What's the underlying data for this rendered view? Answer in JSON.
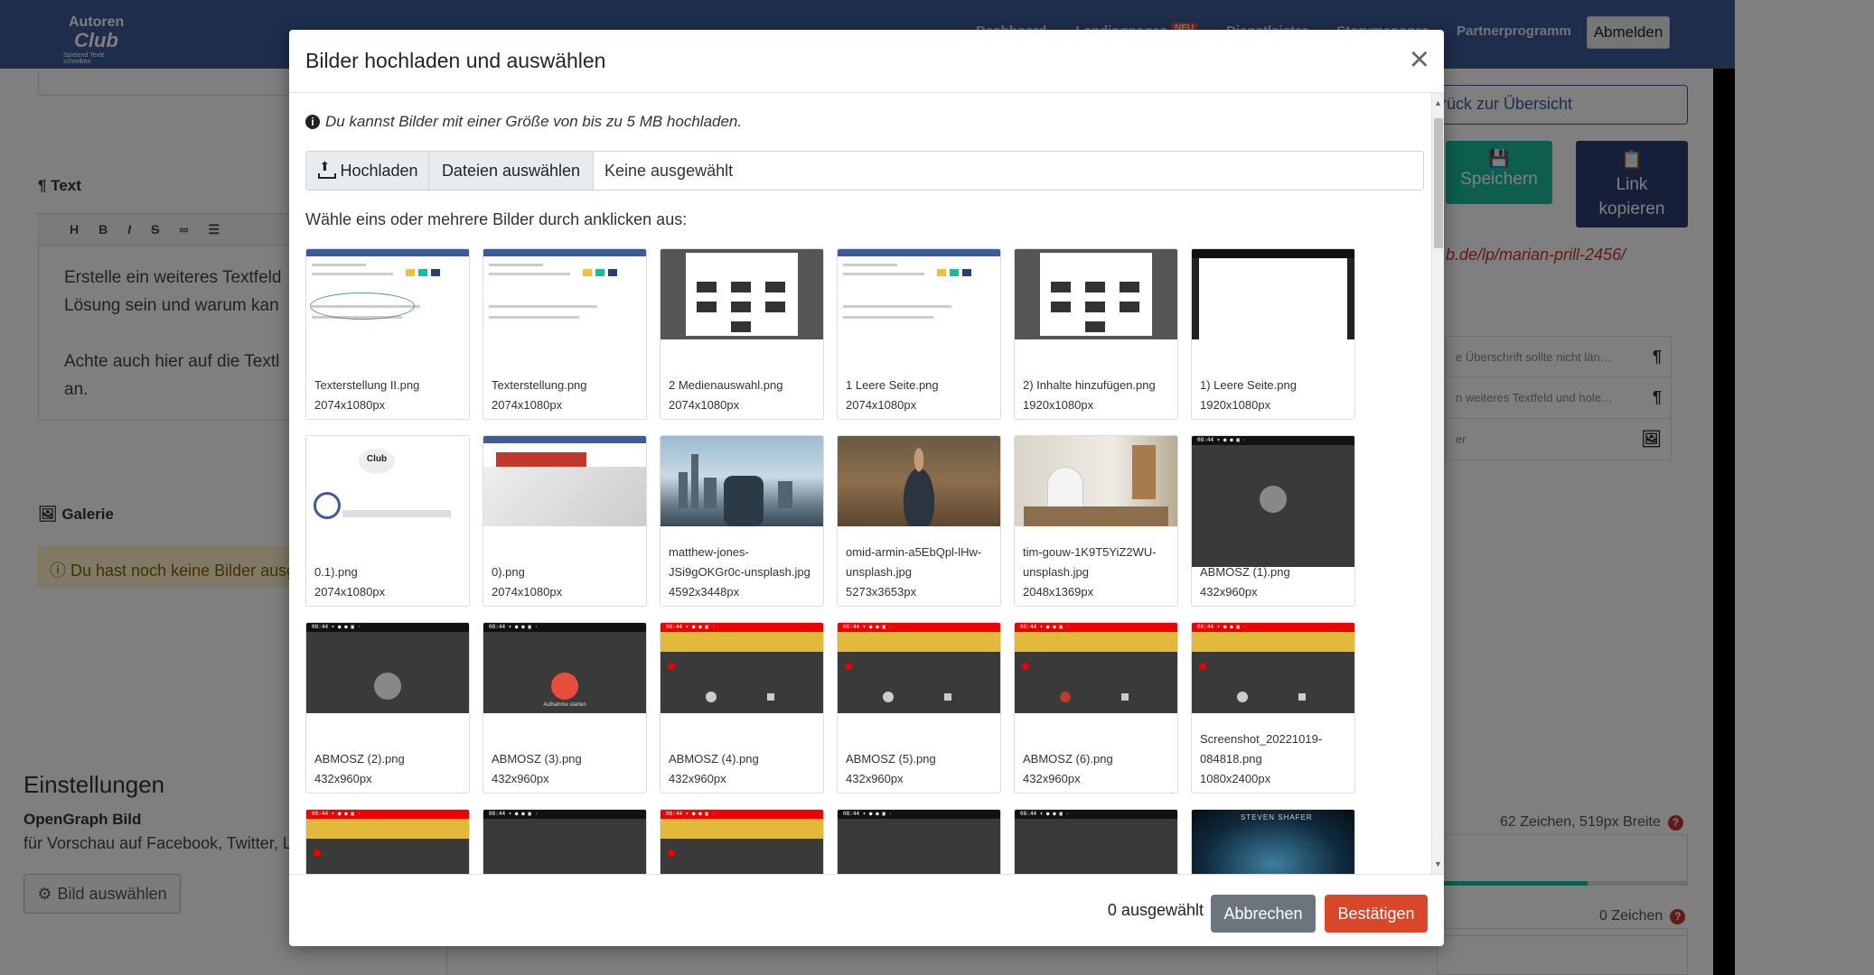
{
  "app": {
    "logo_top": "Autoren",
    "logo_main": "Club",
    "logo_sub": "Spielend Texte schreiben",
    "nav": [
      "Dashboard",
      "Landingpages",
      "Dienstleister",
      "Storymanager",
      "Partnerprogramm"
    ],
    "nav_badge": "NEU",
    "logout_label": "Abmelden"
  },
  "editor": {
    "text_heading": "Text",
    "toolbar": [
      "H",
      "B",
      "I",
      "S",
      "∞",
      "☰"
    ],
    "body": "Erstelle ein weiteres Textfeld\nLösung sein und warum kan\n\nAchte auch hier auf die Textl\nan.",
    "gallery_heading": "Galerie",
    "gallery_warning": "Du hast noch keine Bilder ausg"
  },
  "settings": {
    "heading": "Einstellungen",
    "og_label": "OpenGraph Bild",
    "og_desc": "für Vorschau auf Facebook, Twitter, L",
    "choose_image_label": "Bild auswählen"
  },
  "sidebar": {
    "back_label": "rück zur Übersicht",
    "save_label": "Speichern",
    "copy_label_1": "Link",
    "copy_label_2": "kopieren",
    "url": "b.de/lp/marian-prill-2456/",
    "items": [
      {
        "label": "e Überschrift sollte nicht län…"
      },
      {
        "label": "n weiteres Textfeld und hole…"
      },
      {
        "label": "er"
      }
    ],
    "chars_1": "62 Zeichen, 519px Breite",
    "chars_2": "0 Zeichen",
    "progress_fraction": 0.6
  },
  "modal": {
    "title": "Bilder hochladen und auswählen",
    "info": "Du kannst Bilder mit einer Größe von bis zu 5 MB hochladen.",
    "upload_label": "Hochladen",
    "files_label": "Dateien auswählen",
    "files_status": "Keine ausgewählt",
    "choose_hint": "Wähle eins oder mehrere Bilder durch anklicken aus:",
    "images": [
      {
        "name": "Texterstellung II.png",
        "size": "2074x1080px",
        "thumb": "web-oval"
      },
      {
        "name": "Texterstellung.png",
        "size": "2074x1080px",
        "thumb": "web"
      },
      {
        "name": "2 Medienauswahl.png",
        "size": "2074x1080px",
        "thumb": "dark"
      },
      {
        "name": "1 Leere Seite.png",
        "size": "2074x1080px",
        "thumb": "web"
      },
      {
        "name": "2) Inhalte hinzufügen.png",
        "size": "1920x1080px",
        "thumb": "dark"
      },
      {
        "name": "1) Leere Seite.png",
        "size": "1920x1080px",
        "thumb": "black-top"
      },
      {
        "name": "0.1).png",
        "size": "2074x1080px",
        "thumb": "logo"
      },
      {
        "name": "0).png",
        "size": "2074x1080px",
        "thumb": "red"
      },
      {
        "name": "matthew-jones-JSi9gOKGr0c-unsplash.jpg",
        "size": "4592x3448px",
        "thumb": "city"
      },
      {
        "name": "omid-armin-a5EbQpl-lHw-unsplash.jpg",
        "size": "5273x3653px",
        "thumb": "forest"
      },
      {
        "name": "tim-gouw-1K9T5YiZ2WU-unsplash.jpg",
        "size": "2048x1369px",
        "thumb": "office"
      },
      {
        "name": "ABMOSZ (1).png",
        "size": "432x960px",
        "thumb": "phone-grey"
      },
      {
        "name": "ABMOSZ (2).png",
        "size": "432x960px",
        "thumb": "phone-grey"
      },
      {
        "name": "ABMOSZ (3).png",
        "size": "432x960px",
        "thumb": "phone-red"
      },
      {
        "name": "ABMOSZ (4).png",
        "size": "432x960px",
        "thumb": "phone-warn"
      },
      {
        "name": "ABMOSZ (5).png",
        "size": "432x960px",
        "thumb": "phone-warn"
      },
      {
        "name": "ABMOSZ (6).png",
        "size": "432x960px",
        "thumb": "phone-warn-dark"
      },
      {
        "name": "Screenshot_20221019-084818.png",
        "size": "1080x2400px",
        "thumb": "phone-warn"
      },
      {
        "name": "",
        "size": "",
        "thumb": "phone-warn-dark"
      },
      {
        "name": "",
        "size": "",
        "thumb": "phone-plain"
      },
      {
        "name": "",
        "size": "",
        "thumb": "phone-warn"
      },
      {
        "name": "",
        "size": "",
        "thumb": "phone-plain"
      },
      {
        "name": "",
        "size": "",
        "thumb": "phone-plain"
      },
      {
        "name": "",
        "size": "",
        "thumb": "movie"
      }
    ],
    "selected_count": "0 ausgewählt",
    "cancel_label": "Abbrechen",
    "confirm_label": "Bestätigen",
    "movie_text": "STEVEN SHAFER"
  }
}
